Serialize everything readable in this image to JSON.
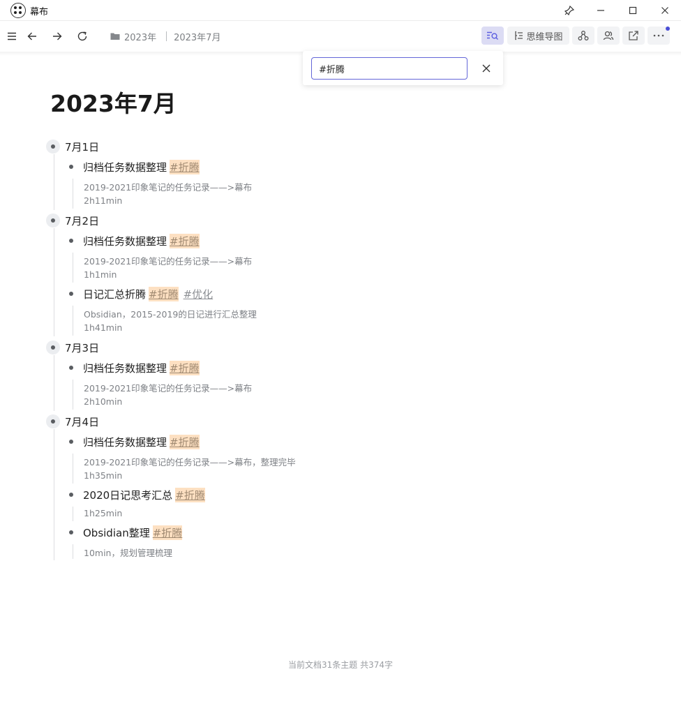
{
  "window": {
    "title": "幕布"
  },
  "breadcrumb": {
    "folder": "2023年",
    "doc": "2023年7月"
  },
  "toolbar": {
    "mindmap_label": "思维导图"
  },
  "search": {
    "value": "#折腾"
  },
  "doc": {
    "title": "2023年7月",
    "days": [
      {
        "label": "7月1日",
        "items": [
          {
            "text": "归档任务数据整理",
            "tags": [
              "#折腾"
            ],
            "notes": [
              "2019-2021印象笔记的任务记录——>幕布",
              "2h11min"
            ]
          }
        ]
      },
      {
        "label": "7月2日",
        "items": [
          {
            "text": "归档任务数据整理",
            "tags": [
              "#折腾"
            ],
            "notes": [
              "2019-2021印象笔记的任务记录——>幕布",
              "1h1min"
            ]
          },
          {
            "text": "日记汇总折腾",
            "tags": [
              "#折腾",
              "#优化"
            ],
            "notes": [
              "Obsidian，2015-2019的日记进行汇总整理",
              "1h41min"
            ]
          }
        ]
      },
      {
        "label": "7月3日",
        "items": [
          {
            "text": "归档任务数据整理",
            "tags": [
              "#折腾"
            ],
            "notes": [
              "2019-2021印象笔记的任务记录——>幕布",
              "2h10min"
            ]
          }
        ]
      },
      {
        "label": "7月4日",
        "items": [
          {
            "text": "归档任务数据整理",
            "tags": [
              "#折腾"
            ],
            "notes": [
              "2019-2021印象笔记的任务记录——>幕布，整理完毕",
              "1h35min"
            ]
          },
          {
            "text": "2020日记思考汇总",
            "tags": [
              "#折腾"
            ],
            "notes": [
              "1h25min"
            ]
          },
          {
            "text": "Obsidian整理",
            "tags": [
              "#折腾"
            ],
            "notes": [
              "10min，规划管理梳理"
            ]
          }
        ]
      }
    ]
  },
  "footer": {
    "stats": "当前文档31条主题 共374字"
  },
  "colors": {
    "accent": "#4a4ed6",
    "tag_highlight": "#fde0c2"
  },
  "icons": [
    "app-logo-icon",
    "pin-icon",
    "minimize-icon",
    "maximize-icon",
    "close-icon",
    "menu-icon",
    "back-icon",
    "forward-icon",
    "refresh-icon",
    "folder-icon",
    "search-doc-icon",
    "mindmap-icon",
    "graph-icon",
    "collab-icon",
    "share-icon",
    "more-icon"
  ]
}
